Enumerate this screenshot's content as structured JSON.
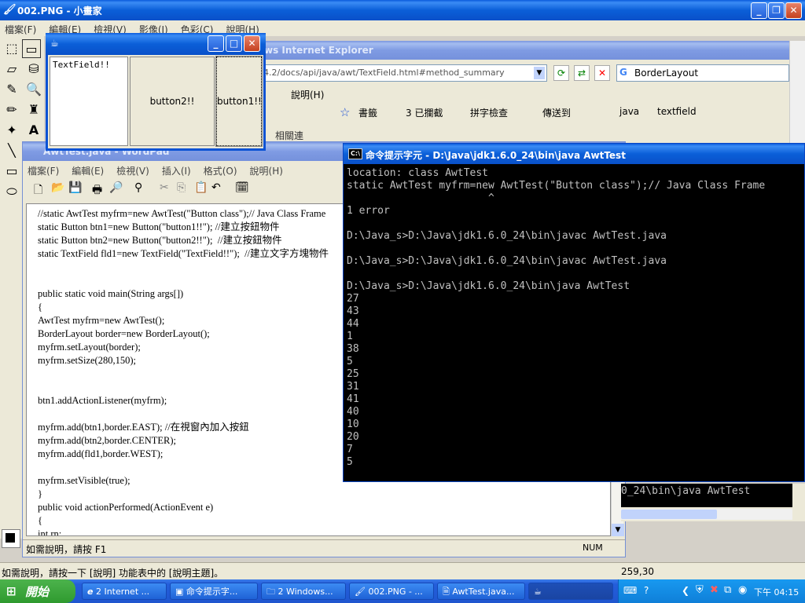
{
  "paint": {
    "title": "002.PNG - 小畫家",
    "menu": [
      "檔案(F)",
      "編輯(E)",
      "檢視(V)",
      "影像(I)",
      "色彩(C)",
      "說明(H)"
    ],
    "status": "如需說明，請按一下 [說明] 功能表中的 [說明主題]。",
    "coords": "259,30"
  },
  "ie": {
    "title": "ws Internet Explorer",
    "address": "4.2/docs/api/java/awt/TextField.html#method_summary",
    "search_value": "BorderLayout",
    "menu_help": "說明(H)",
    "toolbar": {
      "bookmarks": "書籤",
      "blocked": "3 已攔截",
      "spell": "拼字檢查",
      "sendto": "傳送到",
      "java": "java",
      "textfield": "textfield"
    },
    "links_label": "相關連"
  },
  "awt": {
    "textfield": "TextField!!",
    "button2": "button2!!",
    "button1": "button1!!"
  },
  "wordpad": {
    "title": "AwtTest.java - WordPad",
    "menu": [
      "檔案(F)",
      "編輯(E)",
      "檢視(V)",
      "插入(I)",
      "格式(O)",
      "說明(H)"
    ],
    "lines": [
      "//static AwtTest myfrm=new AwtTest(\"Button class\");// Java Class Frame",
      "static Button btn1=new Button(\"button1!!\"); //建立按鈕物件",
      "static Button btn2=new Button(\"button2!!\");  //建立按鈕物件",
      "static TextField fld1=new TextField(\"TextField!!\");  //建立文字方塊物件",
      "",
      "",
      "public static void main(String args[])",
      "{",
      "AwtTest myfrm=new AwtTest();",
      "BorderLayout border=new BorderLayout();",
      "myfrm.setLayout(border);",
      "myfrm.setSize(280,150);",
      "",
      "",
      "btn1.addActionListener(myfrm);",
      "",
      "myfrm.add(btn1,border.EAST); //在視窗內加入按鈕",
      "myfrm.add(btn2,border.CENTER);",
      "myfrm.add(fld1,border.WEST);",
      "",
      "myfrm.setVisible(true);",
      "}",
      "public void actionPerformed(ActionEvent e)",
      "{",
      "int rn;"
    ],
    "status": "如需說明，請按 F1",
    "num": "NUM"
  },
  "cmd": {
    "title": "命令提示字元 - D:\\Java\\jdk1.6.0_24\\bin\\java AwtTest",
    "lines": [
      "location: class AwtTest",
      "static AwtTest myfrm=new AwtTest(\"Button class\");// Java Class Frame",
      "                       ^",
      "1 error",
      "",
      "D:\\Java_s>D:\\Java\\jdk1.6.0_24\\bin\\javac AwtTest.java",
      "",
      "D:\\Java_s>D:\\Java\\jdk1.6.0_24\\bin\\javac AwtTest.java",
      "",
      "D:\\Java_s>D:\\Java\\jdk1.6.0_24\\bin\\java AwtTest",
      "27",
      "43",
      "44",
      "1",
      "38",
      "5",
      "25",
      "31",
      "41",
      "40",
      "10",
      "20",
      "7",
      "5"
    ],
    "behind_line": "0_24\\bin\\java AwtTest"
  },
  "taskbar": {
    "start": "開始",
    "items": [
      "2 Internet ...",
      "命令提示字...",
      "2 Windows...",
      "002.PNG - ...",
      "AwtTest.java...",
      ""
    ],
    "clock": "下午 04:15"
  },
  "colors": {
    "cmd_bg": "#000000",
    "cmd_fg": "#c0c0c0",
    "xp_blue": "#0a5bdc",
    "taskbar": "#245edb"
  }
}
